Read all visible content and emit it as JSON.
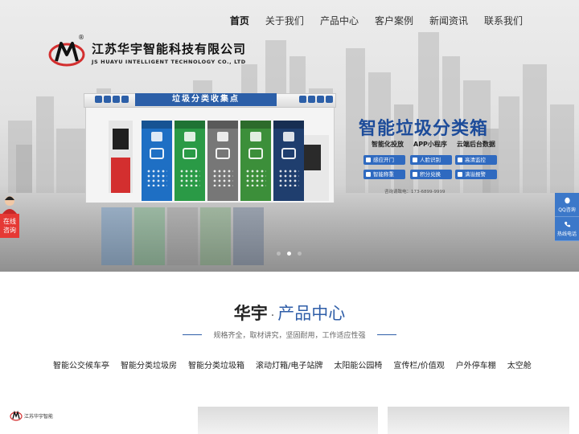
{
  "nav": {
    "items": [
      {
        "label": "首页",
        "active": true
      },
      {
        "label": "关于我们"
      },
      {
        "label": "产品中心"
      },
      {
        "label": "客户案例"
      },
      {
        "label": "新闻资讯"
      },
      {
        "label": "联系我们"
      }
    ]
  },
  "logo": {
    "name_cn": "江苏华宇智能科技有限公司",
    "name_en": "JS HUAYU INTELLIGENT TECHNOLOGY CO., LTD",
    "reg_mark": "®"
  },
  "banner": {
    "kiosk_sign": "垃圾分类收集点",
    "title": "智能垃圾分类箱",
    "subtitles": [
      "智能化投放",
      "APP小程序",
      "云端后台数据"
    ],
    "features": [
      "感应开门",
      "人脸识别",
      "高清监控",
      "智能称重",
      "积分兑换",
      "满溢报警"
    ],
    "hotline": "咨询请致电：173-6899-9999",
    "slide_count": 3,
    "active_slide": 1,
    "bin_colors": [
      "#1e6fc4",
      "#2a9a46",
      "#777777",
      "#3c8f3a",
      "#1f3e6e"
    ]
  },
  "float_left": {
    "label_line1": "在线",
    "label_line2": "咨询"
  },
  "float_right": {
    "items": [
      {
        "icon": "qq-icon",
        "label": "QQ咨询"
      },
      {
        "icon": "phone-icon",
        "label": "热线电话"
      }
    ]
  },
  "section": {
    "title_main": "华宇",
    "title_dot": "·",
    "title_accent": "产品中心",
    "subtitle": "规格齐全，取材讲究，坚固耐用，工作适应性强"
  },
  "categories": [
    "智能公交候车亭",
    "智能分类垃圾房",
    "智能分类垃圾箱",
    "滚动灯箱/电子站牌",
    "太阳能公园椅",
    "宣传栏/价值观",
    "户外停车棚",
    "太空舱"
  ],
  "mini_logo": {
    "text": "江苏华宇智能"
  },
  "colors": {
    "brand_blue": "#2f5ea8",
    "accent_red": "#e53935",
    "float_blue": "#3c78c9"
  }
}
